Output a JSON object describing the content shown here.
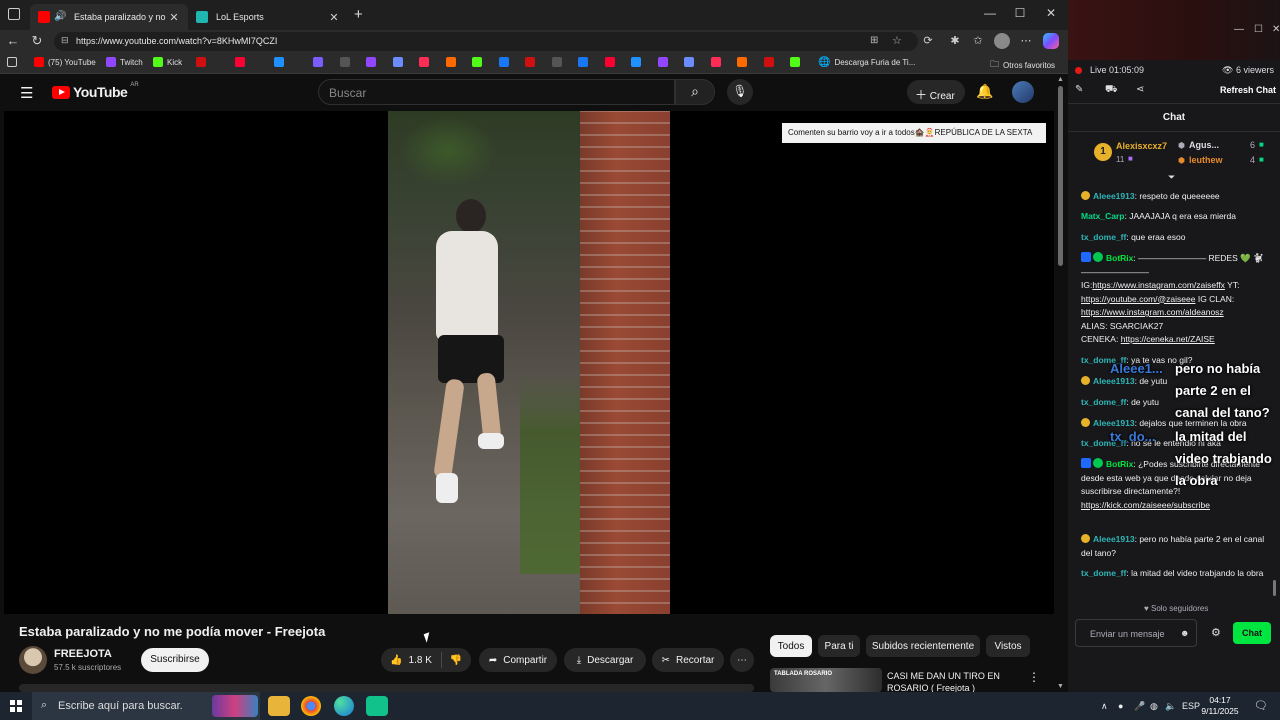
{
  "browser": {
    "tabs": [
      {
        "label": "Estaba paralizado y no me p",
        "favicon_color": "#ff0000",
        "active": true
      },
      {
        "label": "LoL Esports",
        "favicon_color": "#1fb5b0",
        "active": false
      }
    ],
    "new_tab": "+",
    "url": "https://www.youtube.com/watch?v=8KHwMI7QCZI",
    "window_controls": {
      "minimize": "—",
      "maximize": "☐",
      "close": "✕"
    },
    "bookmarks": [
      {
        "label": "(75) YouTube",
        "color": "#ff0000"
      },
      {
        "label": "Twitch",
        "color": "#9146ff"
      },
      {
        "label": "Kick",
        "color": "#53fc18"
      },
      {
        "label": "",
        "color": "#d01010"
      },
      {
        "label": "",
        "color": "#ff0033"
      },
      {
        "label": "",
        "color": "#1e90ff"
      },
      {
        "label": "",
        "color": "#7a5cff"
      },
      {
        "label": "",
        "color": "#555555"
      },
      {
        "label": "",
        "color": "#9146ff"
      },
      {
        "label": "",
        "color": "#6b8cff"
      },
      {
        "label": "",
        "color": "#ff2d55"
      },
      {
        "label": "",
        "color": "#ff6a00"
      },
      {
        "label": "",
        "color": "#53fc18"
      },
      {
        "label": "",
        "color": "#1877f2"
      },
      {
        "label": "",
        "color": "#d01010"
      },
      {
        "label": "",
        "color": "#555555"
      },
      {
        "label": "",
        "color": "#1877f2"
      },
      {
        "label": "",
        "color": "#ff0033"
      },
      {
        "label": "",
        "color": "#1e90ff"
      },
      {
        "label": "",
        "color": "#9146ff"
      },
      {
        "label": "",
        "color": "#6b8cff"
      },
      {
        "label": "",
        "color": "#ff2d55"
      },
      {
        "label": "",
        "color": "#ff6a00"
      },
      {
        "label": "",
        "color": "#d01010"
      },
      {
        "label": "",
        "color": "#53fc18"
      }
    ],
    "bookmark_globe_label": "Descarga Furia de Ti...",
    "other_favorites": "Otros favoritos"
  },
  "youtube": {
    "logo_text": "YouTube",
    "logo_region": "AR",
    "search_placeholder": "Buscar",
    "create_label": "Crear",
    "video_overlay_caption": "Comenten su barrio voy a ir a todos🏚️🤶REPÚBLICA DE LA SEXTA",
    "video_title": "Estaba paralizado y no me podía mover - Freejota",
    "channel_name": "FREEJOTA",
    "channel_subs": "57.5 k suscriptores",
    "subscribe_label": "Suscribirse",
    "like_count": "1.8 K",
    "share_label": "Compartir",
    "download_label": "Descargar",
    "clip_label": "Recortar",
    "more_label": "⋯",
    "chips": [
      "Todos",
      "Para ti",
      "Subidos recientemente",
      "Vistos"
    ],
    "recommended": {
      "thumb_text": "TABLADA ROSARIO",
      "title": "CASI ME DAN UN TIRO EN ROSARIO ( Freejota )"
    }
  },
  "stream": {
    "live_label": "Live 01:05:09",
    "viewers": "6 viewers",
    "refresh_label": "Refresh Chat",
    "chat_header": "Chat",
    "leaderboard": [
      {
        "name": "Alexisxcxz7",
        "count": "11"
      },
      {
        "name": "Agus...",
        "count": "6"
      },
      {
        "name": "leuthew",
        "count": "4"
      }
    ],
    "messages": [
      {
        "user": "Aleee1913",
        "text": ": respeto de queeeeee"
      },
      {
        "user": "Matx_Carp",
        "text": ": JAAAJAJA q era esa mierda"
      },
      {
        "user": "tx_dome_ff",
        "text": ": que eraa esoo"
      },
      {
        "user": "BotRix",
        "text": ": ———————— REDES 💚 🐩————————"
      },
      {
        "text": "IG:",
        "link1": "https://www.instagram.com/zaiseffx",
        "text2": " YT:",
        "link2": "https://youtube.com/@zaiseee",
        "text3": " IG CLAN:",
        "link3": "https://www.instagram.com/aldeanosz",
        "text4": "ALIAS: SGARCIAK27",
        "text5": "CENEKA: ",
        "link4": "https://ceneka.net/ZAISE"
      },
      {
        "user": "tx_dome_ff",
        "text": ": ya te vas no gil?"
      },
      {
        "user": "Aleee1913",
        "text": ": de yutu"
      },
      {
        "user": "tx_dome_ff",
        "text": ": de yutu"
      },
      {
        "user": "Aleee1913",
        "text": ": dejalos que terminen la obra"
      },
      {
        "user": "tx_dome_ff",
        "text": ": no se le entendio ni aka"
      },
      {
        "user": "BotRix",
        "text": ": ¿Podes suscribirte directamente desde esta web ya que desde celular no deja suscribirse directamente?!",
        "link": "https://kick.com/zaiseee/subscribe"
      },
      {
        "user": "Aleee1913",
        "text": ": pero no había parte 2 en el canal del tano?"
      },
      {
        "user": "tx_dome_ff",
        "text": ": la mitad del video trabjando la obra"
      }
    ],
    "overlay_user1": "Aleee1...",
    "overlay_user2": "tx_do...",
    "overlay_lines": [
      "pero no había",
      "parte 2 en el",
      "canal del tano?",
      "la mitad del",
      "video trabjando",
      "la obra"
    ],
    "followers_only": "Solo seguidores",
    "send_placeholder": "Enviar un mensaje",
    "chat_button": "Chat"
  },
  "taskbar": {
    "search_placeholder": "Escribe aquí para buscar.",
    "lang": "ESP",
    "time": "04:17",
    "date": "9/11/2025"
  }
}
